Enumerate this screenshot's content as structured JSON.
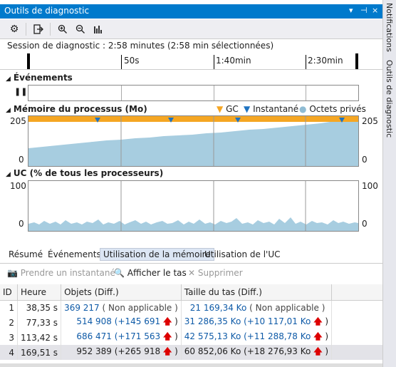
{
  "window": {
    "title": "Outils de diagnostic",
    "controls": [
      "▾",
      "⊣",
      "×"
    ]
  },
  "toolbar": {
    "items": [
      "settings-icon",
      "export-icon",
      "zoom-in-icon",
      "zoom-out-icon",
      "reset-zoom-icon"
    ]
  },
  "session": {
    "text": "Session de diagnostic : 2:58 minutes (2:58 min sélectionnées)"
  },
  "ruler": {
    "ticks": [
      "50s",
      "1:40min",
      "2:30min"
    ]
  },
  "events": {
    "label": "Événements",
    "pause_icon": "❚❚"
  },
  "memory": {
    "label": "Mémoire du processus (Mo)",
    "legend": {
      "gc": "GC",
      "snapshot": "Instantané",
      "private": "Octets privés"
    },
    "y_top": "205",
    "y_bottom": "0",
    "colors": {
      "gc": "#f5a623",
      "snapshot": "#1f73c1",
      "private": "#a7cde0"
    },
    "snapshot_times_s": [
      38.35,
      77.33,
      113.42,
      169.51
    ]
  },
  "cpu": {
    "label": "UC (% de tous les processeurs)",
    "y_top": "100",
    "y_bottom": "0"
  },
  "tabs": [
    "Résumé",
    "Événements",
    "Utilisation de la mémoire",
    "Utilisation de l'UC"
  ],
  "actions": {
    "snapshot": "Prendre un instantané",
    "heap": "Afficher le tas",
    "delete": "Supprimer"
  },
  "table": {
    "headers": [
      "ID",
      "Heure",
      "Objets (Diff.)",
      "Taille du tas (Diff.)"
    ],
    "rows": [
      {
        "id": "1",
        "time": "38,35 s",
        "objects": "369 217",
        "objects_diff": "( Non applicable )",
        "heap": "21 169,34 Ko",
        "heap_diff": "( Non applicable )"
      },
      {
        "id": "2",
        "time": "77,33 s",
        "objects": "514 908",
        "objects_diff": "(+145 691",
        "heap": "31 286,35 Ko",
        "heap_diff": "(+10 117,01 Ko"
      },
      {
        "id": "3",
        "time": "113,42 s",
        "objects": "686 471",
        "objects_diff": "(+171 563",
        "heap": "42 575,13 Ko",
        "heap_diff": "(+11 288,78 Ko"
      },
      {
        "id": "4",
        "time": "169,51 s",
        "objects": "952 389",
        "objects_diff": "(+265 918",
        "heap": "60 852,06 Ko",
        "heap_diff": "(+18 276,93 Ko"
      }
    ]
  },
  "side": {
    "notifications": "Notifications",
    "diag": "Outils de diagnostic"
  }
}
